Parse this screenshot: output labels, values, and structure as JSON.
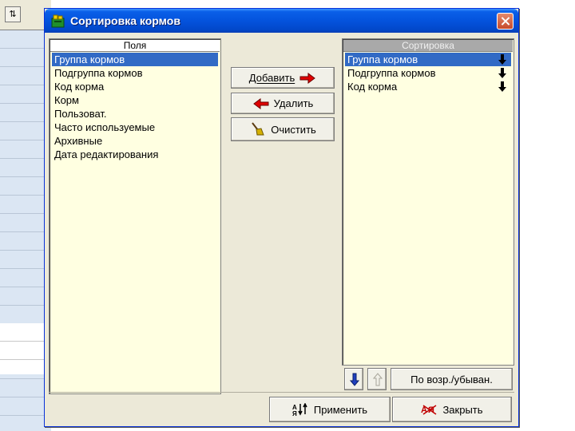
{
  "background": {
    "toolbar_icon": "sort-icon"
  },
  "dialog": {
    "title": "Сортировка кормов",
    "title_icon": "feed-box-icon",
    "close_icon": "close-icon"
  },
  "fields_panel": {
    "header": "Поля",
    "items": [
      {
        "label": "Группа кормов",
        "selected": true
      },
      {
        "label": "Подгруппа кормов",
        "selected": false
      },
      {
        "label": "Код корма",
        "selected": false
      },
      {
        "label": "Корм",
        "selected": false
      },
      {
        "label": "Пользоват.",
        "selected": false
      },
      {
        "label": "Часто используемые",
        "selected": false
      },
      {
        "label": "Архивные",
        "selected": false
      },
      {
        "label": "Дата редактирования",
        "selected": false
      }
    ]
  },
  "sort_panel": {
    "header": "Сортировка",
    "items": [
      {
        "label": "Группа кормов",
        "selected": true,
        "direction_icon": "arrow-down-icon"
      },
      {
        "label": "Подгруппа кормов",
        "selected": false,
        "direction_icon": "arrow-down-icon"
      },
      {
        "label": "Код корма",
        "selected": false,
        "direction_icon": "arrow-down-icon"
      }
    ]
  },
  "buttons": {
    "add": "Добавить",
    "remove": "Удалить",
    "clear": "Очистить",
    "asc_desc": "По возр./убыван.",
    "apply": "Применить",
    "close": "Закрыть"
  },
  "colors": {
    "title_bar": "#0453dd",
    "selection": "#316ac5",
    "list_background": "#ffffe1",
    "arrow_red": "#e00000",
    "arrow_blue": "#1f3fbf"
  }
}
